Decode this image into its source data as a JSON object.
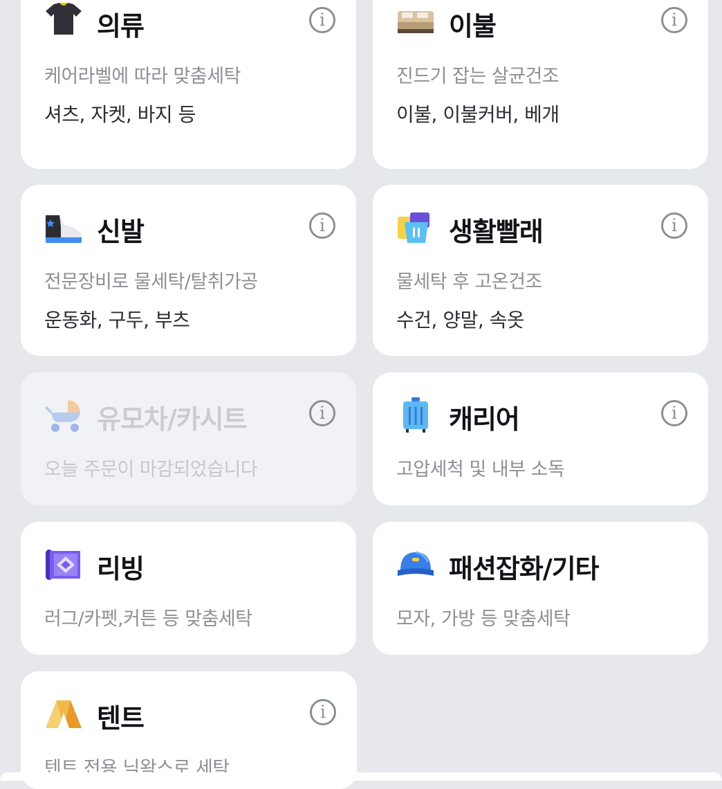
{
  "categories": [
    {
      "title": "의류",
      "desc": "케어라벨에 따라 맞춤세탁",
      "items": "셔츠, 자켓, 바지 등"
    },
    {
      "title": "이불",
      "desc": "진드기 잡는 살균건조",
      "items": "이불, 이불커버, 베개"
    },
    {
      "title": "신발",
      "desc": "전문장비로 물세탁/탈취가공",
      "items": "운동화, 구두, 부츠"
    },
    {
      "title": "생활빨래",
      "desc": "물세탁 후 고온건조",
      "items": "수건, 양말, 속옷"
    },
    {
      "title": "유모차/카시트",
      "desc": "오늘 주문이 마감되었습니다",
      "items": ""
    },
    {
      "title": "캐리어",
      "desc": "고압세척 및 내부 소독",
      "items": ""
    },
    {
      "title": "리빙",
      "desc": "러그/카펫,커튼 등 맞춤세탁",
      "items": ""
    },
    {
      "title": "패션잡화/기타",
      "desc": "모자, 가방 등 맞춤세탁",
      "items": ""
    },
    {
      "title": "텐트",
      "desc": "텐트 전용 닉왁스로 세탁",
      "items": ""
    }
  ],
  "icons": {
    "clothes": "tshirt-icon",
    "bedding": "bed-icon",
    "shoes": "sneaker-icon",
    "daily": "laundry-basket-icon",
    "stroller": "stroller-icon",
    "carrier": "suitcase-icon",
    "living": "rug-icon",
    "fashion": "cap-icon",
    "tent": "tent-icon"
  },
  "info_glyph": "i",
  "colors": {
    "disabled_text": "#c9ccd2",
    "background": "#e7e8ec"
  }
}
